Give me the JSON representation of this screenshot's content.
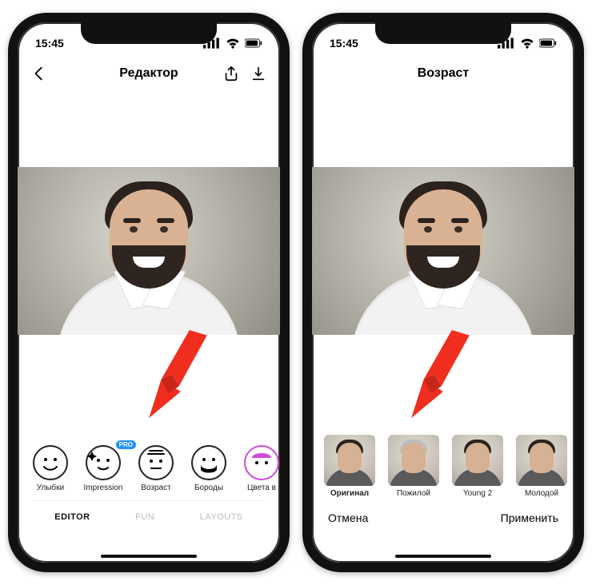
{
  "left": {
    "status_time": "15:45",
    "nav_title": "Редактор",
    "filters": [
      {
        "label": "Улыбки"
      },
      {
        "label": "Impression",
        "pro": "PRO"
      },
      {
        "label": "Возраст"
      },
      {
        "label": "Бороды"
      },
      {
        "label": "Цвета в"
      }
    ],
    "tabs": {
      "editor": "EDITOR",
      "fun": "FUN",
      "layouts": "LAYOUTS"
    }
  },
  "right": {
    "status_time": "15:45",
    "nav_title": "Возраст",
    "options": [
      {
        "label": "Оригинал",
        "hair": "#2b221d",
        "selected": true
      },
      {
        "label": "Пожилой",
        "hair": "#bdbdbd"
      },
      {
        "label": "Young 2",
        "hair": "#2b221d"
      },
      {
        "label": "Молодой",
        "hair": "#2b221d"
      }
    ],
    "cancel": "Отмена",
    "apply": "Применить"
  }
}
